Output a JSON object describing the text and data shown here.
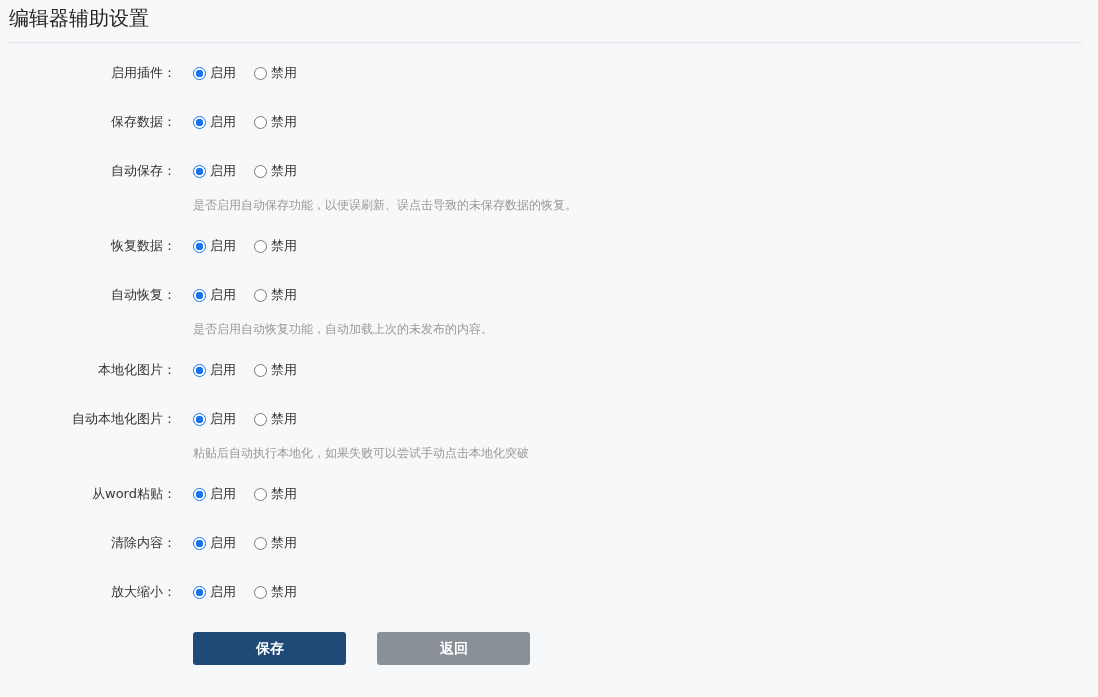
{
  "page": {
    "title": "编辑器辅助设置"
  },
  "settings": [
    {
      "label": "启用插件：",
      "options": [
        {
          "label": "启用",
          "selected": true
        },
        {
          "label": "禁用",
          "selected": false
        }
      ]
    },
    {
      "label": "保存数据：",
      "options": [
        {
          "label": "启用",
          "selected": true
        },
        {
          "label": "禁用",
          "selected": false
        }
      ]
    },
    {
      "label": "自动保存：",
      "options": [
        {
          "label": "启用",
          "selected": true
        },
        {
          "label": "禁用",
          "selected": false
        }
      ],
      "help": "是否启用自动保存功能，以便误刷新、误点击导致的未保存数据的恢复。"
    },
    {
      "label": "恢复数据：",
      "options": [
        {
          "label": "启用",
          "selected": true
        },
        {
          "label": "禁用",
          "selected": false
        }
      ]
    },
    {
      "label": "自动恢复：",
      "options": [
        {
          "label": "启用",
          "selected": true
        },
        {
          "label": "禁用",
          "selected": false
        }
      ],
      "help": "是否启用自动恢复功能，自动加载上次的未发布的内容。"
    },
    {
      "label": "本地化图片：",
      "options": [
        {
          "label": "启用",
          "selected": true
        },
        {
          "label": "禁用",
          "selected": false
        }
      ]
    },
    {
      "label": "自动本地化图片：",
      "options": [
        {
          "label": "启用",
          "selected": true
        },
        {
          "label": "禁用",
          "selected": false
        }
      ],
      "help": "粘贴后自动执行本地化，如果失败可以尝试手动点击本地化突破"
    },
    {
      "label": "从word粘贴：",
      "options": [
        {
          "label": "启用",
          "selected": true
        },
        {
          "label": "禁用",
          "selected": false
        }
      ]
    },
    {
      "label": "清除内容：",
      "options": [
        {
          "label": "启用",
          "selected": true
        },
        {
          "label": "禁用",
          "selected": false
        }
      ]
    },
    {
      "label": "放大缩小：",
      "options": [
        {
          "label": "启用",
          "selected": true
        },
        {
          "label": "禁用",
          "selected": false
        }
      ]
    }
  ],
  "buttons": [
    {
      "label": "保存",
      "kind": "primary"
    },
    {
      "label": "返回",
      "kind": "secondary"
    }
  ]
}
